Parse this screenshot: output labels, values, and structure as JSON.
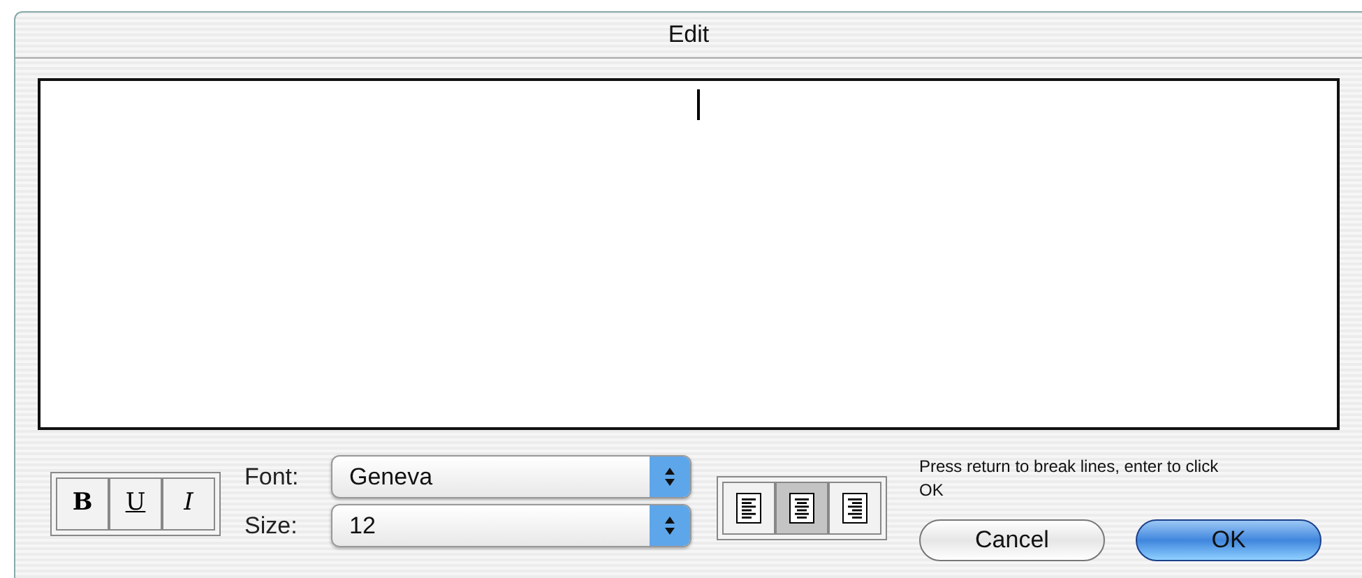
{
  "window": {
    "title": "Edit"
  },
  "style_buttons": [
    {
      "label": "B",
      "kind": "bold",
      "selected": false
    },
    {
      "label": "U",
      "kind": "underline",
      "selected": false
    },
    {
      "label": "I",
      "kind": "italic",
      "selected": false
    }
  ],
  "font": {
    "label": "Font:",
    "value": "Geneva"
  },
  "size": {
    "label": "Size:",
    "value": "12"
  },
  "align_buttons": [
    {
      "kind": "left",
      "selected": false
    },
    {
      "kind": "center",
      "selected": true
    },
    {
      "kind": "right",
      "selected": false
    }
  ],
  "hint": "Press return to break lines, enter to click OK",
  "buttons": [
    {
      "label": "Cancel",
      "kind": "secondary"
    },
    {
      "label": "OK",
      "kind": "default"
    }
  ]
}
